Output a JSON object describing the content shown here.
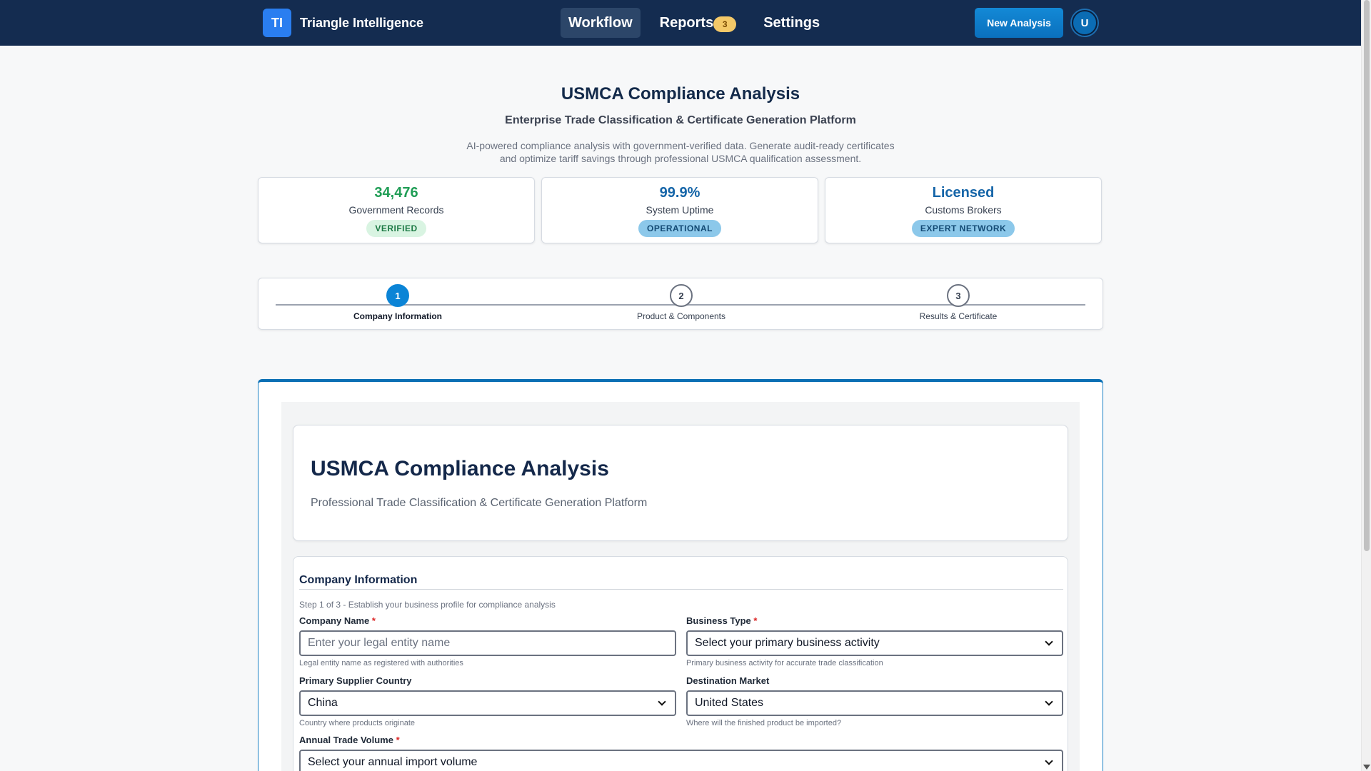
{
  "brand": {
    "logo": "TI",
    "name": "Triangle Intelligence"
  },
  "nav": {
    "items": [
      {
        "label": "Workflow",
        "active": true
      },
      {
        "label": "Reports",
        "badge": "3"
      },
      {
        "label": "Settings"
      }
    ],
    "new_button": "New Analysis",
    "avatar": "U"
  },
  "hero": {
    "title": "USMCA Compliance Analysis",
    "subtitle": "Enterprise Trade Classification & Certificate Generation Platform",
    "description": "AI-powered compliance analysis with government-verified data. Generate audit-ready certificates and optimize tariff savings through professional USMCA qualification assessment."
  },
  "stats": [
    {
      "value": "34,476",
      "label": "Government Records",
      "badge": "VERIFIED",
      "color": "#1f9d55"
    },
    {
      "value": "99.9%",
      "label": "System Uptime",
      "badge": "OPERATIONAL",
      "color": "#1565a8"
    },
    {
      "value": "Licensed",
      "label": "Customs Brokers",
      "badge": "EXPERT NETWORK",
      "color": "#1565a8"
    }
  ],
  "steps": [
    {
      "number": "1",
      "label": "Company Information",
      "active": true
    },
    {
      "number": "2",
      "label": "Product & Components"
    },
    {
      "number": "3",
      "label": "Results & Certificate"
    }
  ],
  "panel": {
    "title": "USMCA Compliance Analysis",
    "subtitle": "Professional Trade Classification & Certificate Generation Platform"
  },
  "form": {
    "title": "Company Information",
    "step_text": "Step 1 of 3 - Establish your business profile for compliance analysis",
    "company_name": {
      "label": "Company Name",
      "required": "*",
      "placeholder": "Enter your legal entity name",
      "help": "Legal entity name as registered with authorities"
    },
    "business_type": {
      "label": "Business Type",
      "required": "*",
      "value": "Select your primary business activity",
      "help": "Primary business activity for accurate trade classification"
    },
    "supplier_country": {
      "label": "Primary Supplier Country",
      "value": "China",
      "help": "Country where products originate"
    },
    "destination_market": {
      "label": "Destination Market",
      "value": "United States",
      "help": "Where will the finished product be imported?"
    },
    "trade_volume": {
      "label": "Annual Trade Volume",
      "required": "*",
      "value": "Select your annual import volume"
    }
  },
  "colors": {
    "nav_bg": "#142c50",
    "accent": "#0b84d6",
    "success": "#1f9d55"
  }
}
